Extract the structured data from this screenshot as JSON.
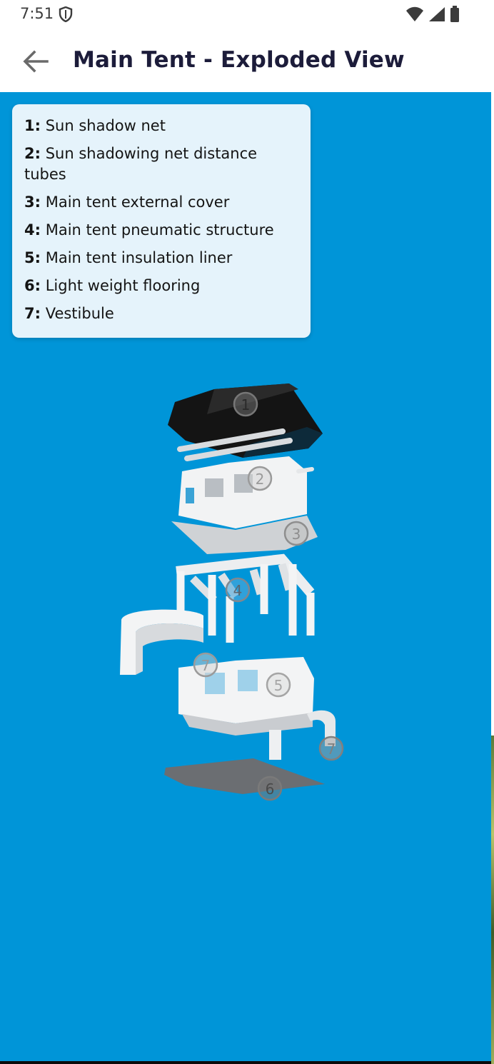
{
  "status_bar": {
    "time": "7:51",
    "icons": [
      "shield-icon",
      "wifi-icon",
      "signal-icon",
      "battery-icon"
    ]
  },
  "app_bar": {
    "back_icon": "arrow-back-icon",
    "title": "Main Tent - Exploded View"
  },
  "legend": {
    "items": [
      {
        "number": "1:",
        "label": "Sun shadow net"
      },
      {
        "number": "2:",
        "label": "Sun shadowing net distance tubes"
      },
      {
        "number": "3:",
        "label": "Main tent external cover"
      },
      {
        "number": "4:",
        "label": "Main tent pneumatic structure"
      },
      {
        "number": "5:",
        "label": "Main tent insulation liner"
      },
      {
        "number": "6:",
        "label": "Light weight flooring"
      },
      {
        "number": "7:",
        "label": "Vestibule"
      }
    ]
  },
  "model_markers": [
    "1",
    "2",
    "3",
    "4",
    "7",
    "5",
    "7",
    "6"
  ],
  "colors": {
    "viewer_background": "#0095d8",
    "legend_background": "#e5f3fb",
    "title": "#1c1c3a"
  }
}
